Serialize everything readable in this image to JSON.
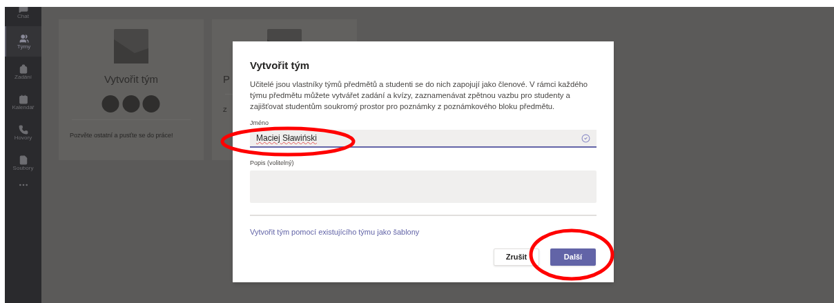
{
  "sidebar": {
    "items": [
      {
        "label": "Chat",
        "selected": false
      },
      {
        "label": "Týmy",
        "selected": true
      },
      {
        "label": "Zadání",
        "selected": false
      },
      {
        "label": "Kalendář",
        "selected": false
      },
      {
        "label": "Hovory",
        "selected": false
      },
      {
        "label": "Soubory",
        "selected": false
      }
    ]
  },
  "cards": [
    {
      "title": "Vytvořit tým",
      "text": "Pozvěte ostatní a pusťte se do práce!"
    },
    {
      "title": "P",
      "text": "Z"
    }
  ],
  "dialog": {
    "title": "Vytvořit tým",
    "description": "Učitelé jsou vlastníky týmů předmětů a studenti se do nich zapojují jako členové. V rámci každého týmu předmětu můžete vytvářet zadání a kvízy, zaznamenávat zpětnou vazbu pro studenty a zajišťovat studentům soukromý prostor pro poznámky z poznámkového bloku předmětu.",
    "name_field": {
      "label": "Jméno",
      "value": "Maciej Sławiński"
    },
    "description_field": {
      "label": "Popis (volitelný)"
    },
    "template_link": "Vytvořit tým pomocí existujícího týmu jako šablony",
    "buttons": [
      {
        "label": "Zrušit",
        "kind": "secondary"
      },
      {
        "label": "Další",
        "kind": "primary"
      }
    ]
  }
}
